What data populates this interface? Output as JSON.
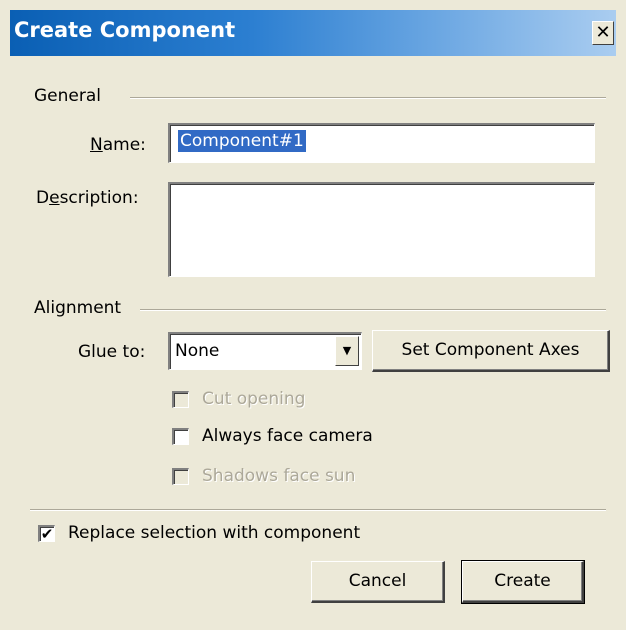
{
  "window": {
    "title": "Create Component",
    "close_glyph": "✕"
  },
  "general": {
    "group_label": "General",
    "name_label": "Name:",
    "name_value": "Component#1",
    "description_label": "Description:",
    "description_value": ""
  },
  "alignment": {
    "group_label": "Alignment",
    "glue_label": "Glue to:",
    "glue_value": "None",
    "set_axes_label": "Set Component Axes",
    "cut_opening": {
      "label": "Cut opening",
      "checked": false,
      "enabled": false
    },
    "always_face_camera": {
      "label": "Always face camera",
      "checked": false,
      "enabled": true
    },
    "shadows_face_sun": {
      "label": "Shadows face sun",
      "checked": false,
      "enabled": false
    }
  },
  "replace_selection": {
    "label": "Replace selection with component",
    "checked": true,
    "check_glyph": "✔"
  },
  "buttons": {
    "cancel": "Cancel",
    "create": "Create"
  },
  "icons": {
    "dropdown_arrow": "▼"
  }
}
